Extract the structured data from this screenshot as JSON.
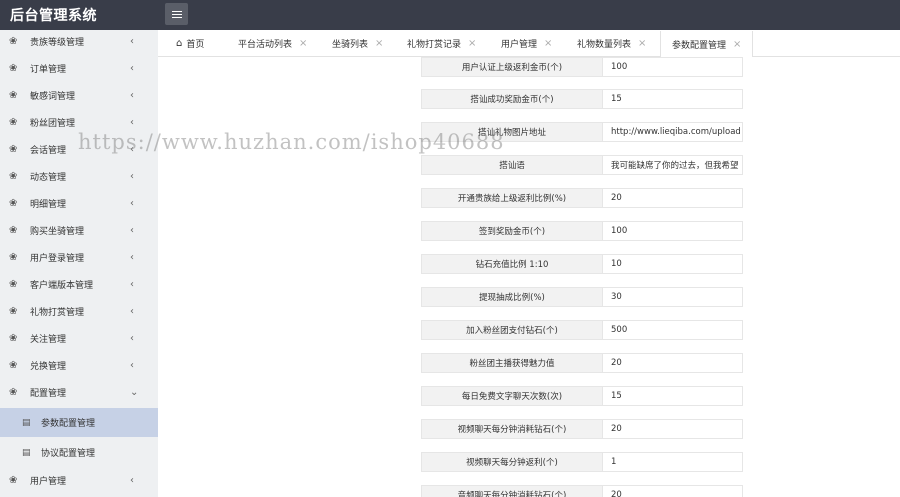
{
  "app_title": "后台管理系统",
  "sidebar": {
    "items": [
      {
        "label": "贵族等级管理",
        "icon": "cluster-icon",
        "chevron": "‹"
      },
      {
        "label": "订单管理",
        "icon": "cluster-icon",
        "chevron": "‹"
      },
      {
        "label": "敏感词管理",
        "icon": "cluster-icon",
        "chevron": "‹"
      },
      {
        "label": "粉丝团管理",
        "icon": "cluster-icon",
        "chevron": "‹"
      },
      {
        "label": "会话管理",
        "icon": "cluster-icon",
        "chevron": "‹"
      },
      {
        "label": "动态管理",
        "icon": "cluster-icon",
        "chevron": "‹"
      },
      {
        "label": "明细管理",
        "icon": "cluster-icon",
        "chevron": "‹"
      },
      {
        "label": "购买坐骑管理",
        "icon": "cluster-icon",
        "chevron": "‹"
      },
      {
        "label": "用户登录管理",
        "icon": "cluster-icon",
        "chevron": "‹"
      },
      {
        "label": "客户端版本管理",
        "icon": "cluster-icon",
        "chevron": "‹"
      },
      {
        "label": "礼物打赏管理",
        "icon": "cluster-icon",
        "chevron": "‹"
      },
      {
        "label": "关注管理",
        "icon": "cluster-icon",
        "chevron": "‹"
      },
      {
        "label": "兑换管理",
        "icon": "cluster-icon",
        "chevron": "‹"
      },
      {
        "label": "配置管理",
        "icon": "cluster-icon",
        "chevron": "⌄"
      }
    ],
    "sub_items": [
      {
        "label": "参数配置管理",
        "active": true
      },
      {
        "label": "协议配置管理",
        "active": false
      }
    ],
    "last_item": {
      "label": "用户管理",
      "chevron": "‹"
    }
  },
  "tabs": [
    {
      "label": "首页",
      "closable": false,
      "icon": "home-icon"
    },
    {
      "label": "平台活动列表",
      "closable": true
    },
    {
      "label": "坐骑列表",
      "closable": true
    },
    {
      "label": "礼物打赏记录",
      "closable": true
    },
    {
      "label": "用户管理",
      "closable": true
    },
    {
      "label": "礼物数量列表",
      "closable": true
    },
    {
      "label": "参数配置管理",
      "closable": true,
      "active": true
    }
  ],
  "tab_close_glyph": "×",
  "form_rows": [
    {
      "label": "用户认证上级返利金币(个)",
      "value": "100"
    },
    {
      "label": "搭讪成功奖励金币(个)",
      "value": "15"
    },
    {
      "label": "搭讪礼物图片地址",
      "value": "http://www.lieqiba.com/uploads/a"
    },
    {
      "label": "搭讪语",
      "value": "我可能缺席了你的过去，但我希望"
    },
    {
      "label": "开通贵族给上级返利比例(%)",
      "value": "20"
    },
    {
      "label": "签到奖励金币(个)",
      "value": "100"
    },
    {
      "label": "钻石充值比例 1:10",
      "value": "10"
    },
    {
      "label": "提现抽成比例(%)",
      "value": "30"
    },
    {
      "label": "加入粉丝团支付钻石(个)",
      "value": "500"
    },
    {
      "label": "粉丝团主播获得魅力值",
      "value": "20"
    },
    {
      "label": "每日免费文字聊天次数(次)",
      "value": "15"
    },
    {
      "label": "视频聊天每分钟消耗钻石(个)",
      "value": "20"
    },
    {
      "label": "视频聊天每分钟返利(个)",
      "value": "1"
    },
    {
      "label": "音频聊天每分钟消耗钻石(个)",
      "value": "20"
    }
  ],
  "watermark": "https://www.huzhan.com/ishop40688"
}
